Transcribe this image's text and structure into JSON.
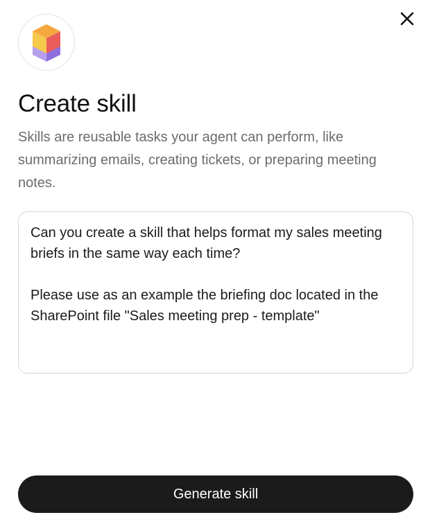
{
  "dialog": {
    "logo_icon": "stacked-cube-logo-icon",
    "close_icon": "close-icon",
    "title": "Create skill",
    "description": "Skills are reusable tasks your agent can perform, like summarizing emails, creating tickets, or preparing meeting notes.",
    "prompt": {
      "value_line_1": "Can you create a skill that helps format my sales meeting briefs in the same way each time?",
      "value_line_2": "Please use as an example the briefing doc located in the SharePoint file \"Sales meeting prep - template\""
    },
    "generate_button_label": "Generate skill"
  },
  "colors": {
    "button_background": "#1b1b1b",
    "logo_top": "#f4a340",
    "logo_right": "#e85a5a",
    "logo_left": "#f6c64a",
    "logo_bottom": "#9b7be6"
  }
}
